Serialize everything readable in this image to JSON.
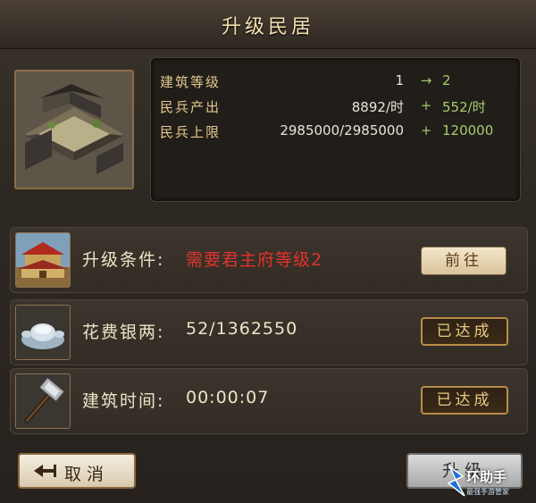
{
  "title": "升级民居",
  "stats": [
    {
      "label": "建筑等级",
      "current": "1",
      "op": "→",
      "next": "2"
    },
    {
      "label": "民兵产出",
      "current": "8892/时",
      "op": "+",
      "next": "552/时"
    },
    {
      "label": "民兵上限",
      "current": "2985000/2985000",
      "op": "+",
      "next": "120000"
    }
  ],
  "requirements": [
    {
      "label": "升级条件:",
      "value": "需要君主府等级2",
      "button": "前往",
      "status": "unmet",
      "icon": "palace-icon"
    },
    {
      "label": "花费银两:",
      "value": "52/1362550",
      "button": "已达成",
      "status": "met",
      "icon": "silver-ingot-icon"
    },
    {
      "label": "建筑时间:",
      "value": "00:00:07",
      "button": "已达成",
      "status": "met",
      "icon": "hammer-icon"
    }
  ],
  "footer": {
    "cancel_label": "取消",
    "upgrade_label": "升级"
  },
  "watermark": {
    "text": "环助手",
    "sub": "最强手游管家"
  }
}
